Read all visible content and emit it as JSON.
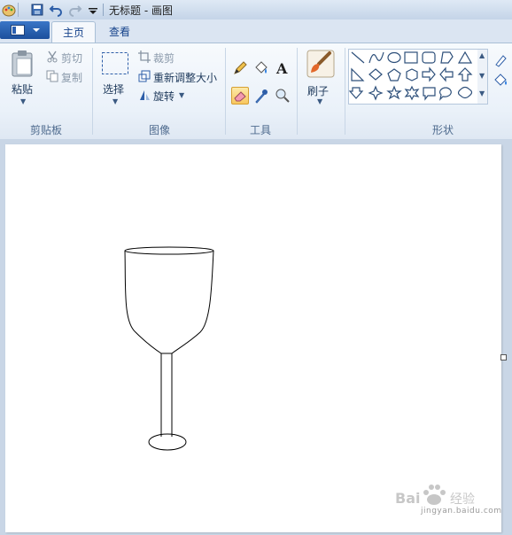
{
  "title_bar": {
    "title": "无标题 - 画图"
  },
  "tabs": [
    {
      "label": "主页",
      "active": true
    },
    {
      "label": "查看",
      "active": false
    }
  ],
  "groups": {
    "clipboard": {
      "label": "剪贴板",
      "paste_label": "粘贴",
      "cut_label": "剪切",
      "copy_label": "复制"
    },
    "image": {
      "label": "图像",
      "select_label": "选择",
      "crop_label": "裁剪",
      "resize_label": "重新调整大小",
      "rotate_label": "旋转"
    },
    "tools": {
      "label": "工具",
      "active_tool": "eraser"
    },
    "brushes": {
      "label": "刷子"
    },
    "shapes": {
      "label": "形状"
    }
  },
  "icons": [
    "paint-app-icon",
    "save-icon",
    "undo-icon",
    "redo-icon",
    "customize-icon",
    "paste-icon",
    "cut-icon",
    "copy-icon",
    "select-icon",
    "crop-icon",
    "resize-icon",
    "rotate-icon",
    "pencil-icon",
    "fill-icon",
    "text-icon",
    "eraser-icon",
    "color-picker-icon",
    "magnifier-icon",
    "brush-icon"
  ],
  "colors": {
    "accent": "#1c4f9c",
    "ribbon": "#eaf1f9",
    "workspace": "#c9d6e6",
    "active_tool": "#f8c760"
  },
  "watermark": {
    "text": "jingyan.baidu.com"
  }
}
